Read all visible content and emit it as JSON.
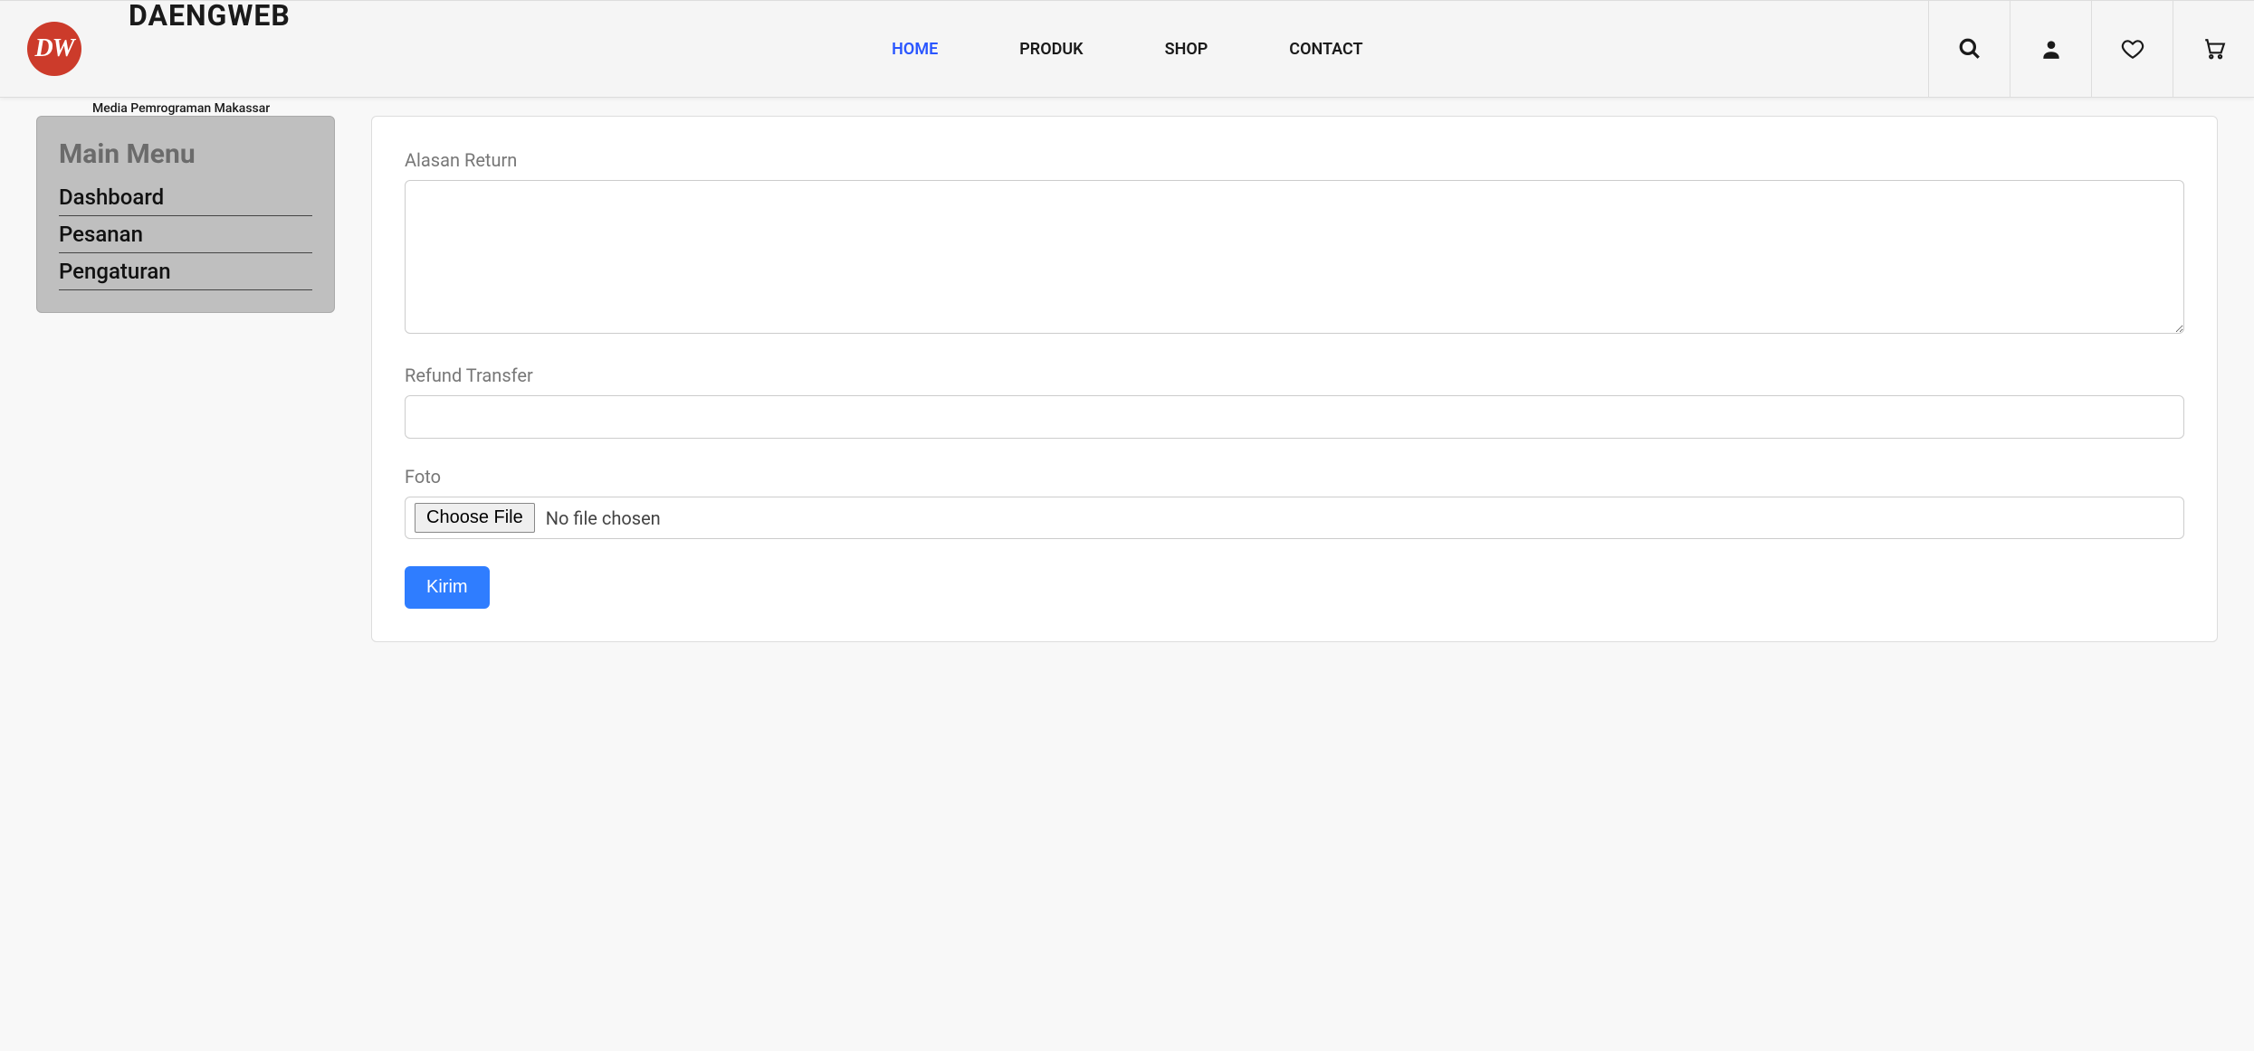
{
  "brand": {
    "mark": "DW",
    "name": "DAENGWEB",
    "tagline": "Media Pemrograman Makassar"
  },
  "nav": {
    "items": [
      "HOME",
      "PRODUK",
      "SHOP",
      "CONTACT"
    ],
    "active_index": 0
  },
  "icons": {
    "search": "search-icon",
    "user": "user-icon",
    "wishlist": "heart-icon",
    "cart": "cart-icon"
  },
  "sidebar": {
    "title": "Main Menu",
    "items": [
      "Dashboard",
      "Pesanan",
      "Pengaturan"
    ]
  },
  "form": {
    "alasan_label": "Alasan Return",
    "alasan_value": "",
    "refund_label": "Refund Transfer",
    "refund_value": "",
    "foto_label": "Foto",
    "choose_file_label": "Choose File",
    "file_status": "No file chosen",
    "submit_label": "Kirim"
  }
}
